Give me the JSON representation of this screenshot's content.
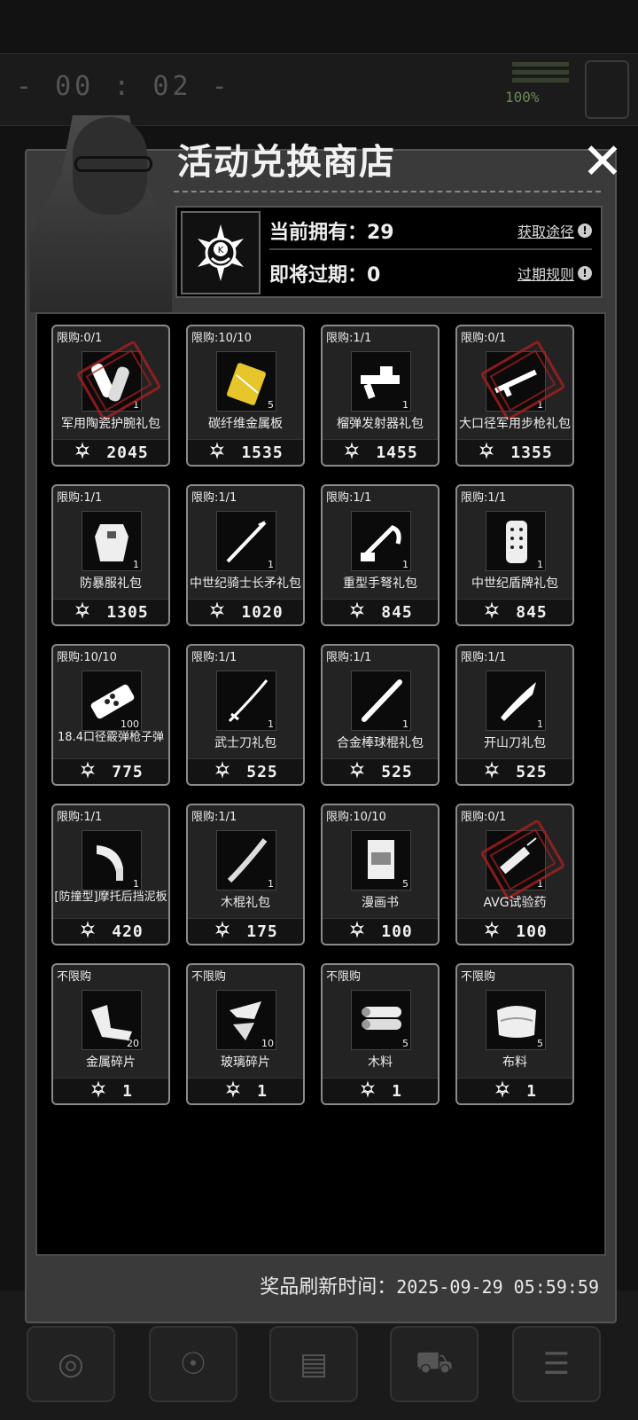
{
  "background": {
    "timer": "- 00 : 02 -",
    "battery": "100%"
  },
  "shop": {
    "title": "活动兑换商店",
    "close_label": "✕",
    "owned_label": "当前拥有：29",
    "expiring_label": "即将过期：0",
    "get_route_label": "获取途径",
    "expire_rules_label": "过期规则",
    "refresh_label": "奖品刷新时间：",
    "refresh_time": "2025-09-29 05:59:59"
  },
  "items": [
    {
      "limit": "限购:0/1",
      "name": "军用陶瓷护腕礼包",
      "qty": "1",
      "price": "2045",
      "icon": "bracer-icon",
      "sold_out": true
    },
    {
      "limit": "限购:10/10",
      "name": "碳纤维金属板",
      "qty": "5",
      "price": "1535",
      "icon": "metal-plate-icon",
      "sold_out": false
    },
    {
      "limit": "限购:1/1",
      "name": "榴弹发射器礼包",
      "qty": "1",
      "price": "1455",
      "icon": "grenade-launcher-icon",
      "sold_out": false
    },
    {
      "limit": "限购:0/1",
      "name": "大口径军用步枪礼包",
      "qty": "1",
      "price": "1355",
      "icon": "rifle-icon",
      "sold_out": true
    },
    {
      "limit": "限购:1/1",
      "name": "防暴服礼包",
      "qty": "1",
      "price": "1305",
      "icon": "riot-suit-icon",
      "sold_out": false
    },
    {
      "limit": "限购:1/1",
      "name": "中世纪骑士长矛礼包",
      "qty": "1",
      "price": "1020",
      "icon": "lance-icon",
      "sold_out": false
    },
    {
      "limit": "限购:1/1",
      "name": "重型手弩礼包",
      "qty": "1",
      "price": "845",
      "icon": "crossbow-icon",
      "sold_out": false
    },
    {
      "limit": "限购:1/1",
      "name": "中世纪盾牌礼包",
      "qty": "1",
      "price": "845",
      "icon": "shield-icon",
      "sold_out": false
    },
    {
      "limit": "限购:10/10",
      "name": "18.4口径霰弹枪子弹",
      "qty": "100",
      "price": "775",
      "icon": "shotgun-shell-icon",
      "sold_out": false
    },
    {
      "limit": "限购:1/1",
      "name": "武士刀礼包",
      "qty": "1",
      "price": "525",
      "icon": "katana-icon",
      "sold_out": false
    },
    {
      "limit": "限购:1/1",
      "name": "合金棒球棍礼包",
      "qty": "1",
      "price": "525",
      "icon": "baseball-bat-icon",
      "sold_out": false
    },
    {
      "limit": "限购:1/1",
      "name": "开山刀礼包",
      "qty": "1",
      "price": "525",
      "icon": "machete-icon",
      "sold_out": false
    },
    {
      "limit": "限购:1/1",
      "name": "[防撞型]摩托后挡泥板",
      "qty": "1",
      "price": "420",
      "icon": "fender-icon",
      "sold_out": false
    },
    {
      "limit": "限购:1/1",
      "name": "木棍礼包",
      "qty": "1",
      "price": "175",
      "icon": "stick-icon",
      "sold_out": false
    },
    {
      "limit": "限购:10/10",
      "name": "漫画书",
      "qty": "5",
      "price": "100",
      "icon": "comic-book-icon",
      "sold_out": false
    },
    {
      "limit": "限购:0/1",
      "name": "AVG试验药",
      "qty": "1",
      "price": "100",
      "icon": "syringe-icon",
      "sold_out": true
    },
    {
      "limit": "不限购",
      "name": "金属碎片",
      "qty": "20",
      "price": "1",
      "icon": "metal-scrap-icon",
      "sold_out": false
    },
    {
      "limit": "不限购",
      "name": "玻璃碎片",
      "qty": "10",
      "price": "1",
      "icon": "glass-shard-icon",
      "sold_out": false
    },
    {
      "limit": "不限购",
      "name": "木料",
      "qty": "5",
      "price": "1",
      "icon": "wood-log-icon",
      "sold_out": false
    },
    {
      "limit": "不限购",
      "name": "布料",
      "qty": "5",
      "price": "1",
      "icon": "cloth-icon",
      "sold_out": false
    }
  ]
}
